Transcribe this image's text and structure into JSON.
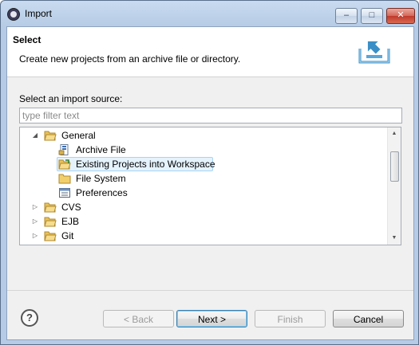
{
  "window": {
    "title": "Import"
  },
  "header": {
    "title": "Select",
    "description": "Create new projects from an archive file or directory."
  },
  "source": {
    "label": "Select an import source:",
    "filter_placeholder": "type filter text",
    "filter_value": ""
  },
  "tree": {
    "items": [
      {
        "label": "General",
        "expanded": true,
        "icon": "folder-open-icon"
      },
      {
        "label": "Archive File",
        "icon": "archive-file-icon"
      },
      {
        "label": "Existing Projects into Workspace",
        "icon": "existing-projects-icon",
        "selected": true
      },
      {
        "label": "File System",
        "icon": "folder-icon"
      },
      {
        "label": "Preferences",
        "icon": "preferences-icon"
      },
      {
        "label": "CVS",
        "expanded": false,
        "icon": "folder-icon"
      },
      {
        "label": "EJB",
        "expanded": false,
        "icon": "folder-icon"
      },
      {
        "label": "Git",
        "expanded": false,
        "icon": "folder-icon"
      }
    ]
  },
  "buttons": {
    "back": "< Back",
    "next": "Next >",
    "finish": "Finish",
    "cancel": "Cancel"
  },
  "colors": {
    "selection_bg": "#e5f3fd",
    "selection_border": "#a9d3f5",
    "folder": "#e8c25a",
    "accent": "#3a8fc7"
  }
}
